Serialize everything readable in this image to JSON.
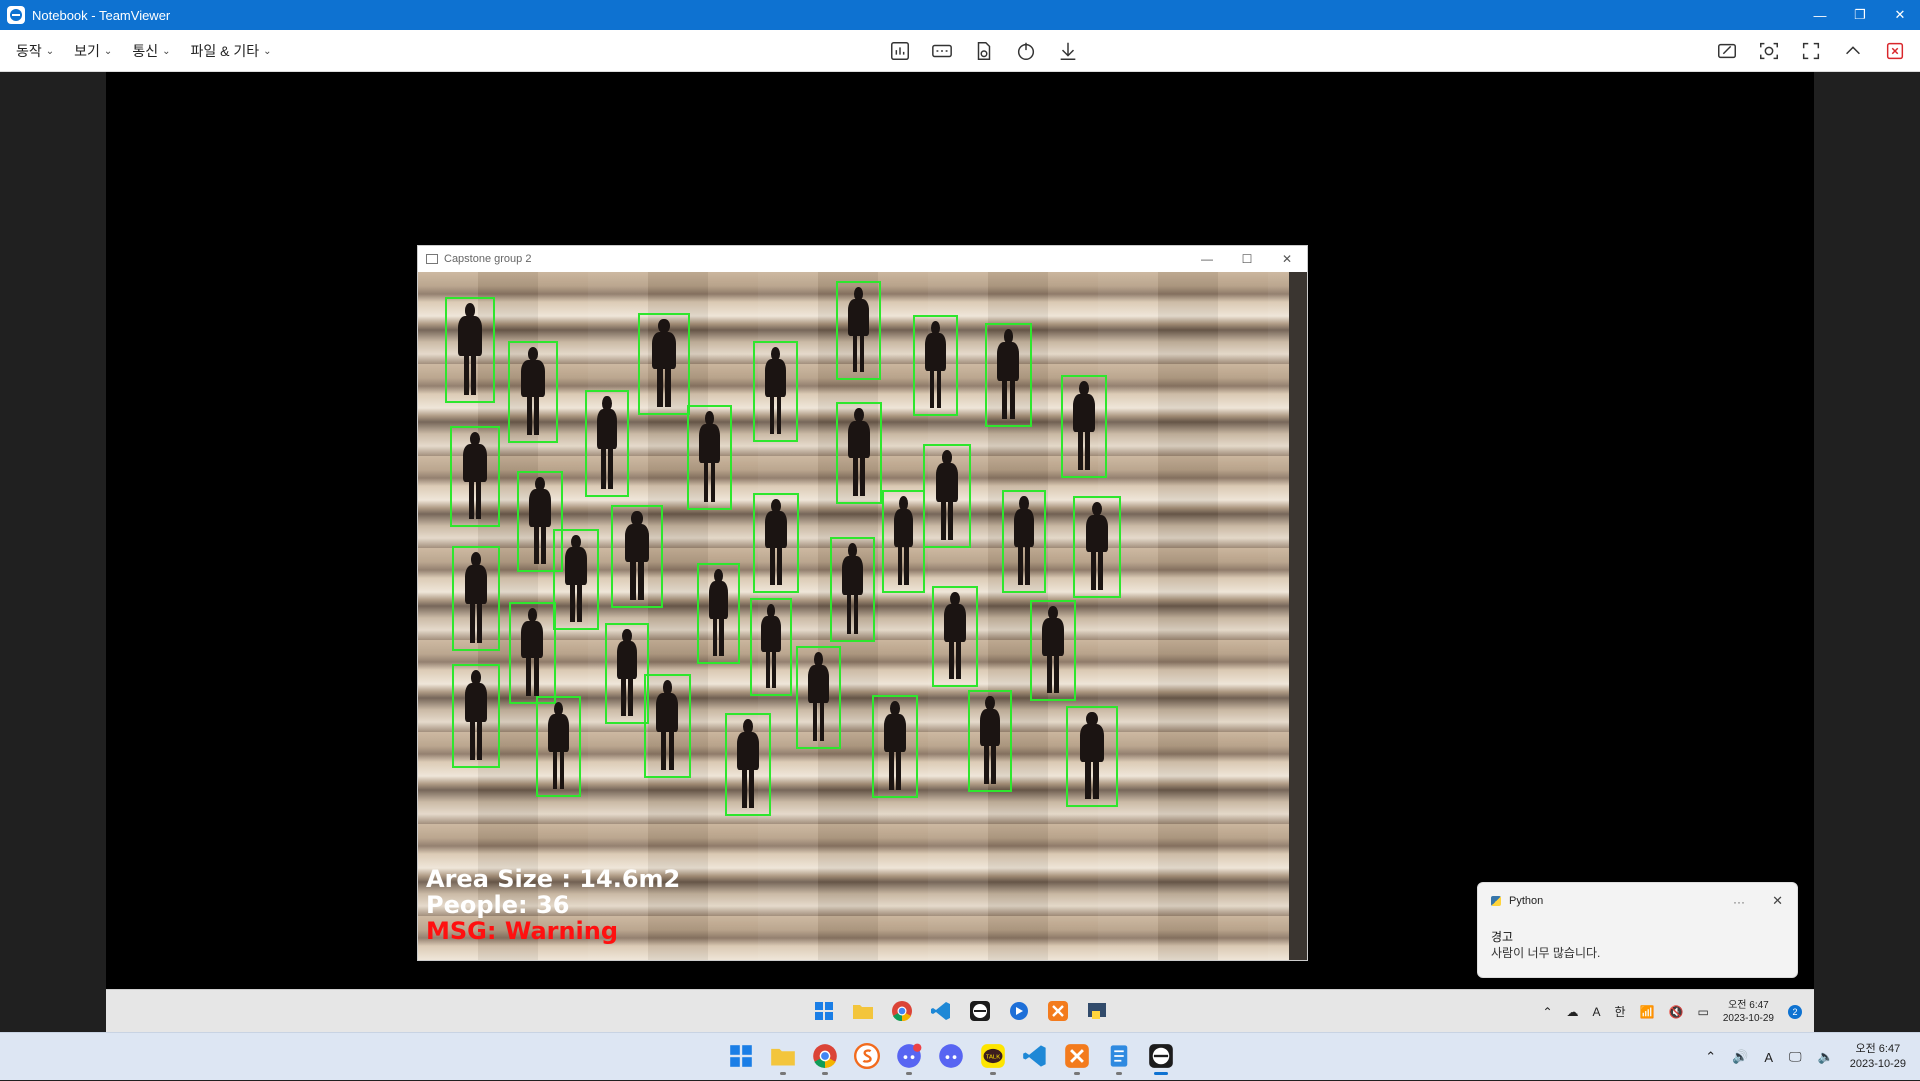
{
  "teamviewer": {
    "title": "Notebook - TeamViewer",
    "window_controls": [
      "—",
      "❐",
      "✕"
    ],
    "menus": [
      {
        "label": "동작"
      },
      {
        "label": "보기"
      },
      {
        "label": "통신"
      },
      {
        "label": "파일 & 기타"
      }
    ],
    "center_tools": [
      "dashboard-icon",
      "remote-input-icon",
      "file-transfer-icon",
      "power-icon",
      "download-icon"
    ],
    "right_tools": [
      "whiteboard-icon",
      "screenshot-icon",
      "fullscreen-icon",
      "collapse-icon",
      "end-session-icon"
    ]
  },
  "capstone_window": {
    "title": "Capstone group 2",
    "controls": [
      "—",
      "☐",
      "✕"
    ],
    "overlay": {
      "area": "Area Size : 14.6m2",
      "people": "People: 36",
      "msg": "MSG: Warning"
    }
  },
  "notification": {
    "app": "Python",
    "more": "···",
    "close": "✕",
    "title": "경고",
    "body": "사람이 너무 많습니다."
  },
  "remote_taskbar": {
    "apps": [
      "start-icon",
      "file-explorer-icon",
      "chrome-icon",
      "vscode-icon",
      "teamviewer-icon",
      "app-arrow-icon",
      "xampp-icon",
      "python-icon"
    ],
    "tray": {
      "ime": "A",
      "lang": "한",
      "time": "오전 6:47",
      "date": "2023-10-29",
      "badge": "2"
    }
  },
  "local_taskbar": {
    "apps": [
      "start-icon",
      "file-explorer-icon",
      "chrome-icon",
      "app-s-icon",
      "discord-badge-icon",
      "discord-icon",
      "kakaotalk-icon",
      "vscode-icon",
      "xampp-icon",
      "notepad-icon",
      "teamviewer-icon"
    ],
    "kakaotalk_label": "TALK",
    "tray": {
      "ime": "A",
      "time": "오전 6:47",
      "date": "2023-10-29"
    }
  },
  "colors": {
    "tv_blue": "#0e72d1",
    "detection_box": "#2ee62e",
    "warning_text": "#ff1010"
  }
}
